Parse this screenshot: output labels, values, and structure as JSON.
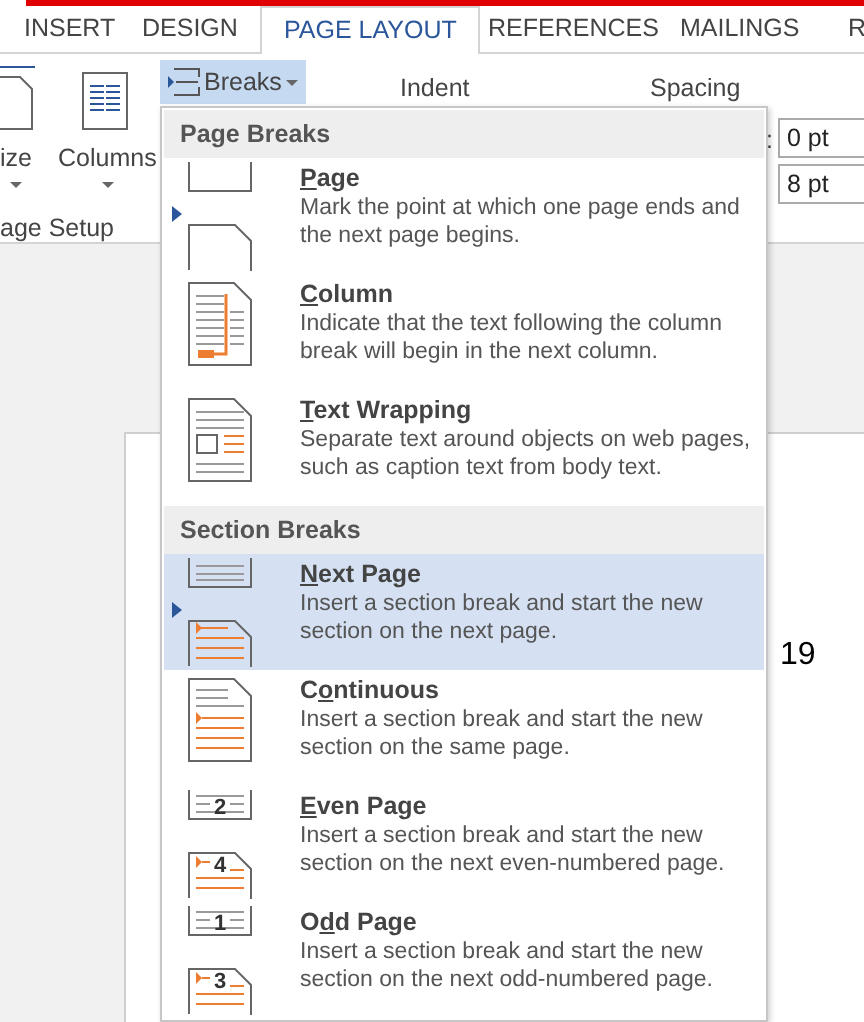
{
  "tabs": [
    {
      "label": "INSERT",
      "selected": false
    },
    {
      "label": "DESIGN",
      "selected": false
    },
    {
      "label": "PAGE LAYOUT",
      "selected": true
    },
    {
      "label": "REFERENCES",
      "selected": false
    },
    {
      "label": "MAILINGS",
      "selected": false
    },
    {
      "label": "R",
      "selected": false
    }
  ],
  "ribbon": {
    "size_label": "ize",
    "columns_label": "Columns",
    "group_label": "age Setup",
    "breaks_button": {
      "label": "Breaks",
      "pressed": true
    },
    "indent_label": "Indent",
    "spacing_label": "Spacing",
    "colon": ":",
    "spacing_fields": [
      {
        "value": "0 pt"
      },
      {
        "value": "8 pt"
      }
    ]
  },
  "breaks_menu": {
    "sections": [
      {
        "header": "Page Breaks",
        "items": [
          {
            "kind": "page",
            "title": {
              "key": "P",
              "after": "age"
            },
            "description": "Mark the point at which one page ends and the next page begins.",
            "selected": false
          },
          {
            "kind": "column",
            "title": {
              "key": "C",
              "after": "olumn"
            },
            "description": "Indicate that the text following the column break will begin in the next column.",
            "selected": false
          },
          {
            "kind": "text_wrapping",
            "title": {
              "key": "T",
              "after": "ext Wrapping"
            },
            "description": "Separate text around objects on web pages, such as caption text from body text.",
            "selected": false
          }
        ]
      },
      {
        "header": "Section Breaks",
        "items": [
          {
            "kind": "next_page",
            "title": {
              "key": "N",
              "after": "ext Page"
            },
            "description": "Insert a section break and start the new section on the next page.",
            "selected": true
          },
          {
            "kind": "continuous",
            "title": {
              "before": "C",
              "key": "o",
              "after": "ntinuous"
            },
            "description": "Insert a section break and start the new section on the same page.",
            "selected": false
          },
          {
            "kind": "even_page",
            "title": {
              "key": "E",
              "after": "ven Page"
            },
            "description": "Insert a section break and start the new section on the next even-numbered page.",
            "numbers": [
              "2",
              "4"
            ],
            "selected": false
          },
          {
            "kind": "odd_page",
            "title": {
              "before": "O",
              "key": "d",
              "after": "d Page"
            },
            "description": "Insert a section break and start the new section on the next odd-numbered page.",
            "numbers": [
              "1",
              "3"
            ],
            "selected": false
          }
        ]
      }
    ]
  },
  "document": {
    "page_number": "19"
  }
}
